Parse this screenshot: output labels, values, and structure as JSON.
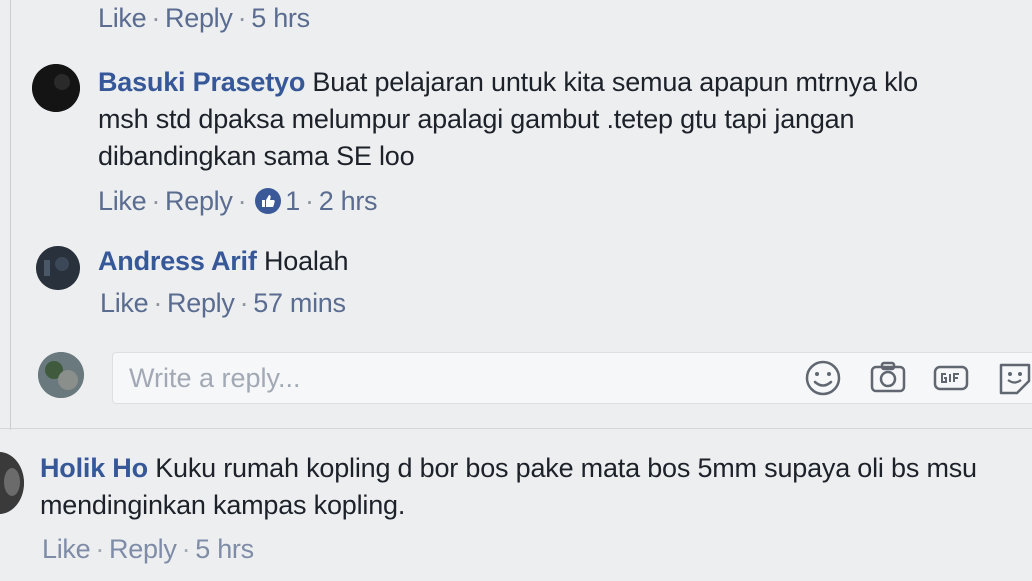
{
  "top_comment_meta": {
    "like": "Like",
    "reply": "Reply",
    "time": "5 hrs"
  },
  "comment_basuki": {
    "author": "Basuki Prasetyo",
    "line1": "Buat pelajaran untuk kita semua apapun mtrnya klo",
    "line2": "msh std dpaksa melumpur apalagi gambut .tetep gtu tapi jangan",
    "line3": "dibandingkan sama SE loo",
    "like": "Like",
    "reply": "Reply",
    "reaction_count": "1",
    "time": "2 hrs"
  },
  "comment_andress": {
    "author": "Andress Arif",
    "text": "Hoalah",
    "like": "Like",
    "reply": "Reply",
    "time": "57 mins"
  },
  "reply_composer": {
    "placeholder": "Write a reply..."
  },
  "comment_holik": {
    "author": "Holik Ho",
    "line1": "Kuku rumah kopling d bor bos pake mata bos 5mm supaya oli bs msu",
    "line2": "mendinginkan kampas kopling.",
    "like": "Like",
    "reply": "Reply",
    "time": "5 hrs"
  },
  "colors": {
    "author_blue": "#365899",
    "meta_blue": "#5b6c91",
    "like_badge": "#3b5998",
    "background": "#eceeef"
  },
  "icons": [
    "emoji-icon",
    "camera-icon",
    "gif-icon",
    "sticker-icon",
    "thumbs-up-icon"
  ]
}
